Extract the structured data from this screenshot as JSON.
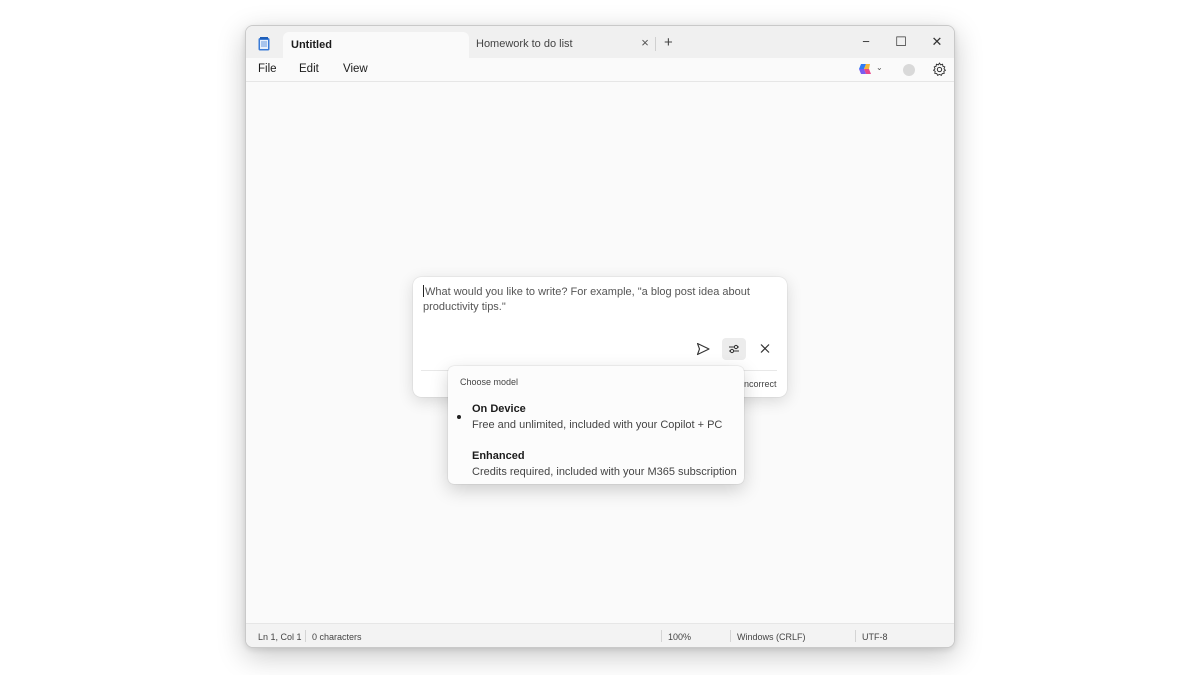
{
  "tabs": {
    "active": "Untitled",
    "inactive": "Homework to do list",
    "close_glyph": "×",
    "add_glyph": "+"
  },
  "window_controls": {
    "minimize": "−",
    "maximize": "☐",
    "close": "✕"
  },
  "menu": {
    "file": "File",
    "edit": "Edit",
    "view": "View"
  },
  "prompt": {
    "placeholder": "What would you like to write? For example, \"a blog post idea about productivity tips.\"",
    "footer_text": "ncorrect",
    "buttons": [
      "send-icon",
      "model-settings-icon",
      "close-icon"
    ]
  },
  "model_menu": {
    "title": "Choose model",
    "options": [
      {
        "name": "On Device",
        "description": "Free and unlimited, included with your Copilot + PC",
        "selected": true
      },
      {
        "name": "Enhanced",
        "description": "Credits required, included with your M365 subscription",
        "selected": false
      }
    ]
  },
  "status": {
    "position": "Ln 1, Col 1",
    "characters": "0 characters",
    "zoom": "100%",
    "line_ending": "Windows (CRLF)",
    "encoding": "UTF-8"
  },
  "colors": {
    "window_bg": "#fafafa",
    "titlebar_bg": "#f0f0f0",
    "app_icon_blue": "#3b7bd6",
    "copilot_gradient": [
      "#2f7bf5",
      "#e8478b",
      "#f6b73c"
    ]
  }
}
